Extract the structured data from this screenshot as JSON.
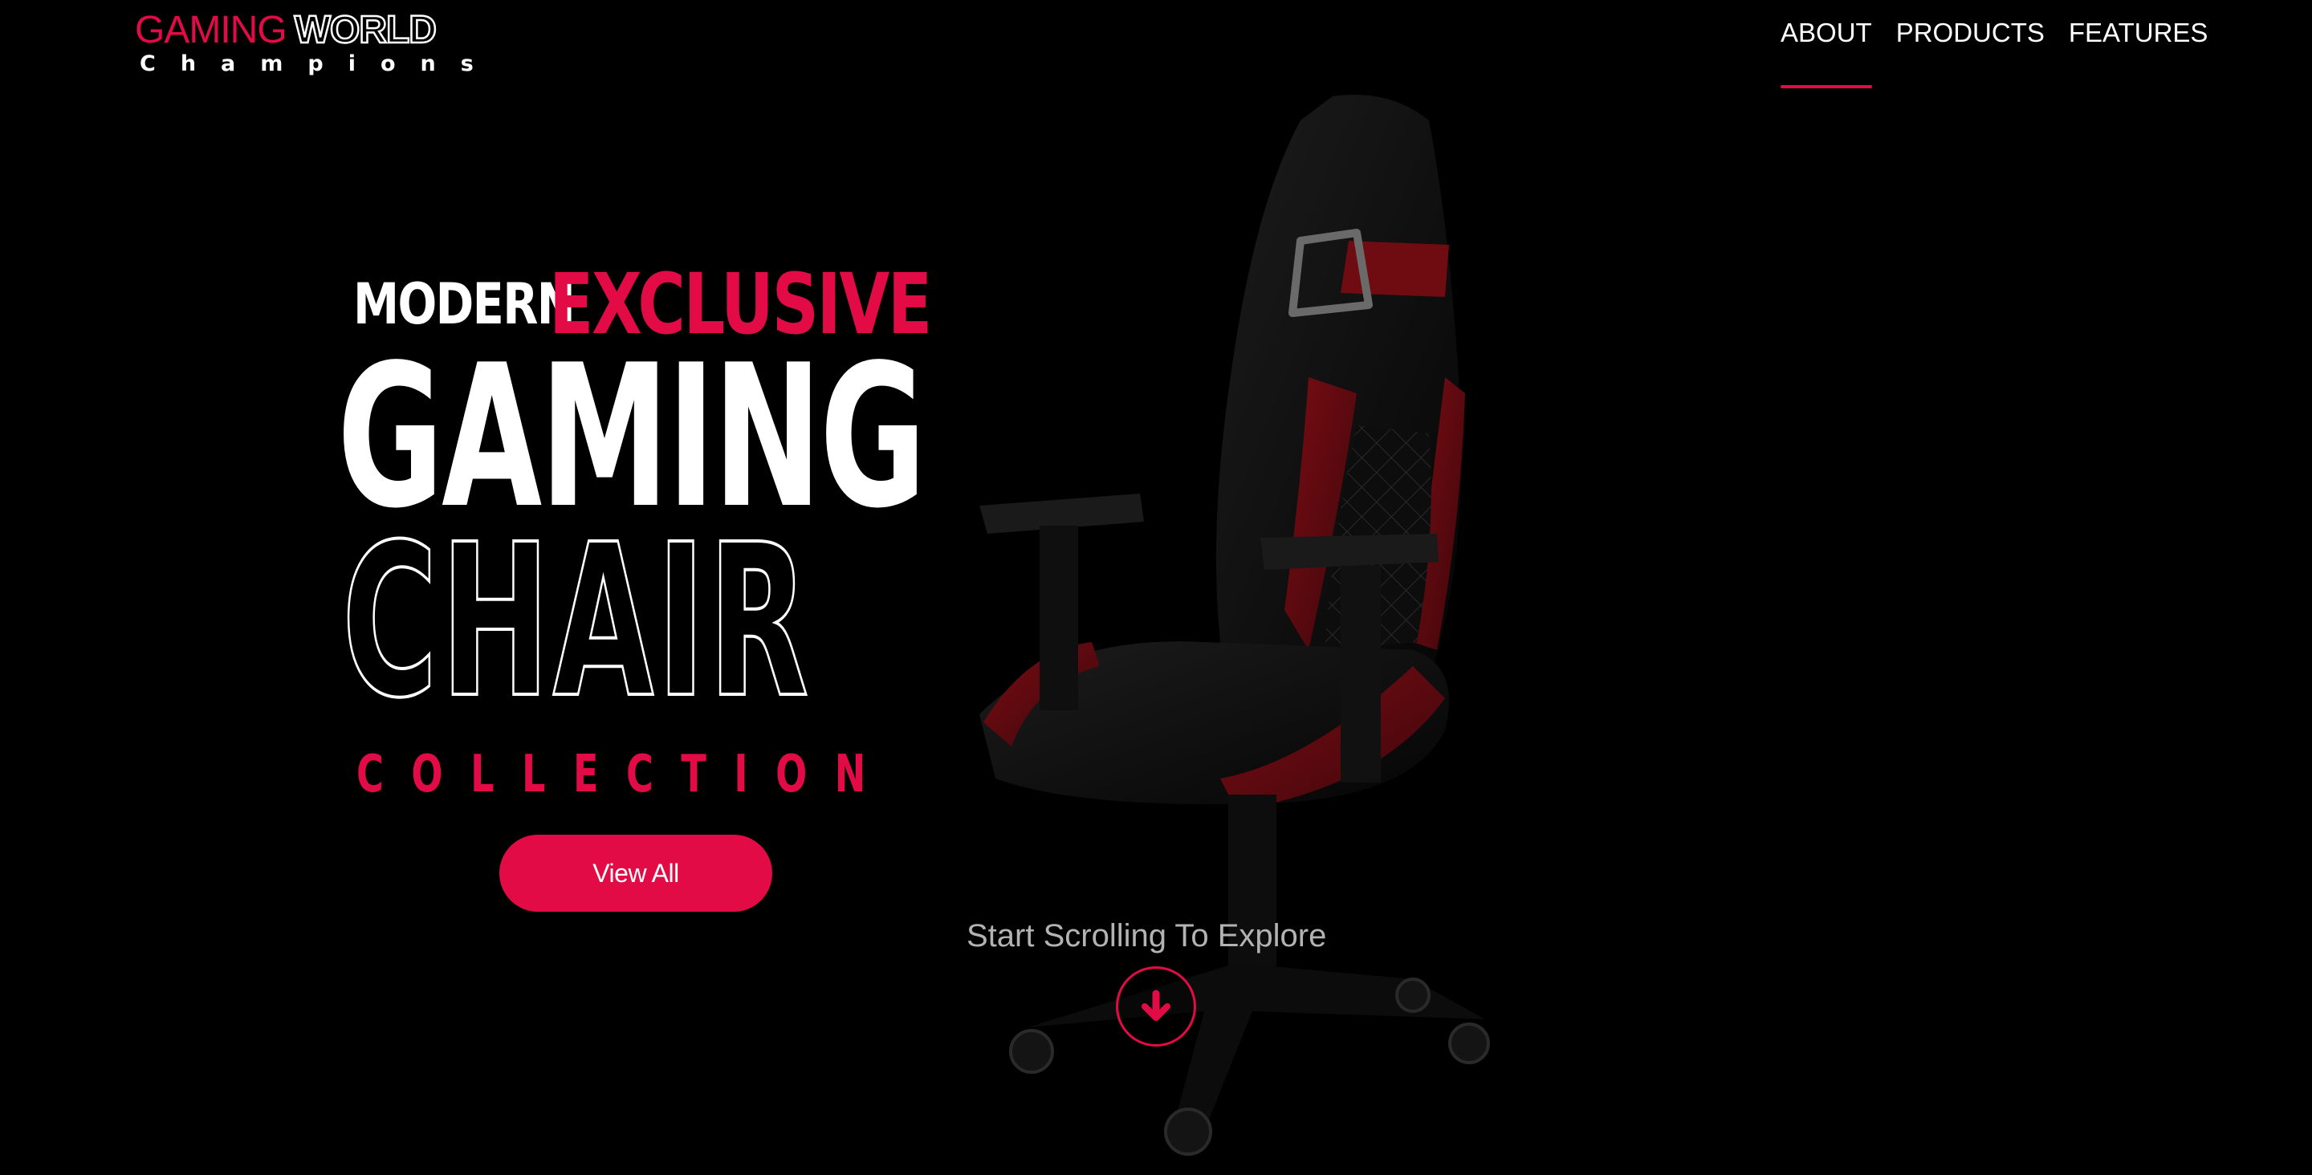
{
  "logo": {
    "primary": "GAMING",
    "secondary": "WORLD",
    "tagline": "Champions"
  },
  "nav": {
    "items": [
      {
        "label": "ABOUT",
        "active": true
      },
      {
        "label": "PRODUCTS"
      },
      {
        "label": "FEATURES"
      }
    ]
  },
  "hero": {
    "word_modern": "MODERN",
    "word_exclusive": "EXCLUSIVE",
    "word_gaming": "GAMING",
    "word_chair": "CHAIR",
    "word_collection": "COLLECTION",
    "cta_label": "View All"
  },
  "scroll": {
    "label": "Start Scrolling To Explore",
    "icon": "arrow-down-icon"
  },
  "colors": {
    "accent": "#e30b45",
    "background": "#000000",
    "text": "#ffffff",
    "muted": "#b3b3b3"
  },
  "product_image": "gaming-chair-black-red"
}
